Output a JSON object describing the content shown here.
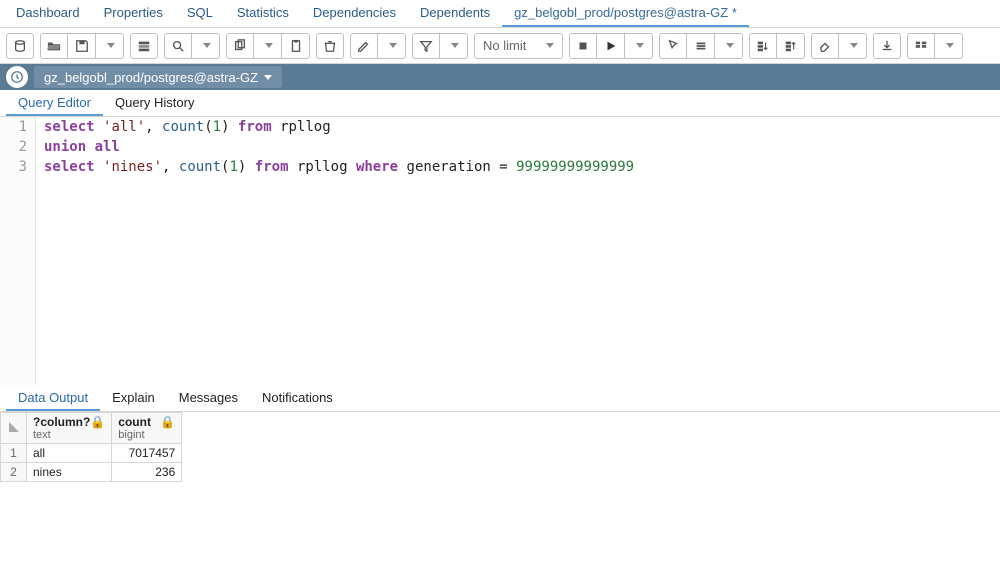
{
  "top_tabs": {
    "items": [
      "Dashboard",
      "Properties",
      "SQL",
      "Statistics",
      "Dependencies",
      "Dependents",
      "gz_belgobl_prod/postgres@astra-GZ *"
    ],
    "active": 6
  },
  "toolbar": {
    "limit_label": "No limit"
  },
  "breadcrumb": {
    "path": "gz_belgobl_prod/postgres@astra-GZ"
  },
  "editor_tabs": {
    "items": [
      "Query Editor",
      "Query History"
    ],
    "active": 0
  },
  "sql": {
    "lines": [
      [
        {
          "t": "select ",
          "c": "kw"
        },
        {
          "t": "'all'",
          "c": "str"
        },
        {
          "t": ", "
        },
        {
          "t": "count",
          "c": "fn"
        },
        {
          "t": "("
        },
        {
          "t": "1",
          "c": "num"
        },
        {
          "t": ") "
        },
        {
          "t": "from ",
          "c": "kw"
        },
        {
          "t": "rpllog"
        }
      ],
      [
        {
          "t": "union all",
          "c": "kw"
        }
      ],
      [
        {
          "t": "select ",
          "c": "kw"
        },
        {
          "t": "'nines'",
          "c": "str"
        },
        {
          "t": ", "
        },
        {
          "t": "count",
          "c": "fn"
        },
        {
          "t": "("
        },
        {
          "t": "1",
          "c": "num"
        },
        {
          "t": ") "
        },
        {
          "t": "from ",
          "c": "kw"
        },
        {
          "t": "rpllog "
        },
        {
          "t": "where ",
          "c": "kw"
        },
        {
          "t": "generation = "
        },
        {
          "t": "99999999999999",
          "c": "num"
        }
      ]
    ]
  },
  "result_tabs": {
    "items": [
      "Data Output",
      "Explain",
      "Messages",
      "Notifications"
    ],
    "active": 0
  },
  "results": {
    "columns": [
      {
        "name": "?column?",
        "type": "text"
      },
      {
        "name": "count",
        "type": "bigint"
      }
    ],
    "rows": [
      [
        "all",
        "7017457"
      ],
      [
        "nines",
        "236"
      ]
    ]
  }
}
